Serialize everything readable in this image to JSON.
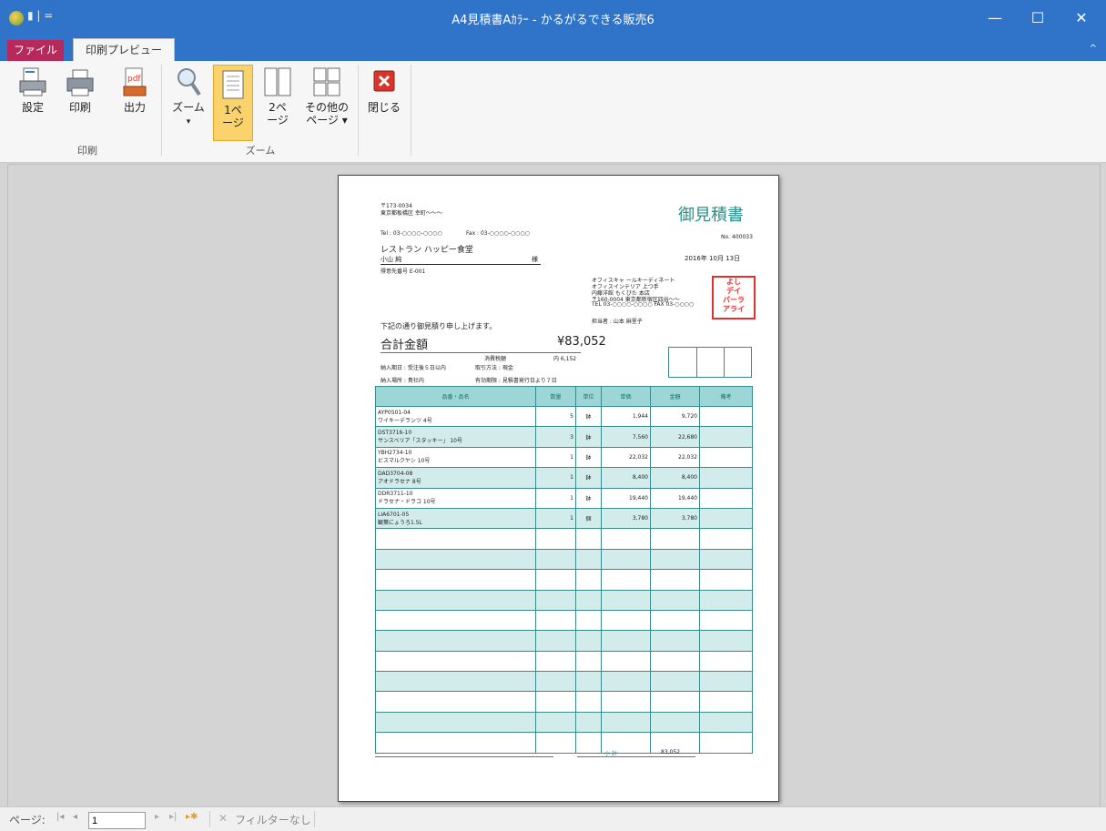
{
  "window": {
    "title": "A4見積書Aｶﾗｰ - かるがるできる販売6",
    "qat": "▮ | =",
    "minimize": "—",
    "maximize": "☐",
    "close": "✕"
  },
  "tabs": {
    "file": "ファイル",
    "preview": "印刷プレビュー",
    "collapse": "^"
  },
  "ribbon": {
    "setup": "設定",
    "print": "印刷",
    "output": "出力",
    "zoom": "ズーム",
    "zoom_caret": "▾",
    "one_page": "1ペ\nージ",
    "two_page": "2ペ\nージ",
    "other_pages": "その他の\nページ ▾",
    "close": "閉じる",
    "group_print": "印刷",
    "group_zoom": "ズーム"
  },
  "icons": {
    "setup": "setup-icon",
    "print": "printer-icon",
    "output": "pdf-icon",
    "zoom": "magnifier-icon",
    "one_page": "one-page-icon",
    "two_page": "two-page-icon",
    "more_pages": "multi-page-icon",
    "close": "close-icon"
  },
  "doc": {
    "postal": "〒173-0034",
    "address": "東京都板橋区 幸町〜〜〜",
    "tel": "Tel : 03-○○○○-○○○○",
    "fax": "Fax : 03-○○○○-○○○○",
    "title": "御見積書",
    "no_label": "No.",
    "no": "400033",
    "customer": "レストラン ハッピー食堂",
    "person": "小山 純",
    "honorific": "様",
    "customer_code": "得意先番号 E-001",
    "date": "2016年 10月 13日",
    "company_lines": [
      "オフィスキャ ールキーディネート",
      "オフィスインテリア 上つ手",
      "内藤洋館 もくびた 本店",
      "〒160-0004 東京都新宿区四谷〜〜",
      "TEL 03-○○○○-○○○○ FAX 03-○○○○"
    ],
    "stamp": "よし\nデイ\nパーラ\nアライ",
    "staff": "担当者 : 山本 麻里子",
    "intro": "下記の通り御見積り申し上げます。",
    "total_label": "合計金額",
    "total_value": "¥83,052",
    "tax_note": "消費税額",
    "tax_value": "内 6,152",
    "delivery": "納入期日 : 受注後５日以内",
    "place": "納入場所 : 貴社内",
    "payment": "取引方法 : 現金",
    "validity": "有効期限 : 見積書発行日より７日",
    "headers": [
      "品番・品名",
      "数量",
      "単位",
      "単価",
      "金額",
      "備考"
    ],
    "rows": [
      {
        "code": "AYP0501-04",
        "name": "ワイキーデランツ 4号",
        "qty": "5",
        "unit": "鉢",
        "price": "1,944",
        "amount": "9,720",
        "note": ""
      },
      {
        "code": "DST3716-10",
        "name": "サンスベリア「スタッキー」 10号",
        "qty": "3",
        "unit": "鉢",
        "price": "7,560",
        "amount": "22,680",
        "note": ""
      },
      {
        "code": "YBH2734-10",
        "name": "ビスマルクヤシ 10号",
        "qty": "1",
        "unit": "鉢",
        "price": "22,032",
        "amount": "22,032",
        "note": ""
      },
      {
        "code": "DAD3704-08",
        "name": "アオドラセナ 8号",
        "qty": "1",
        "unit": "鉢",
        "price": "8,400",
        "amount": "8,400",
        "note": ""
      },
      {
        "code": "DDR3711-10",
        "name": "ドラセナ・ドラコ 10号",
        "qty": "1",
        "unit": "鉢",
        "price": "19,440",
        "amount": "19,440",
        "note": ""
      },
      {
        "code": "LIA6701-05",
        "name": "観葉にょうろ1.5L",
        "qty": "1",
        "unit": "個",
        "price": "3,780",
        "amount": "3,780",
        "note": ""
      }
    ],
    "subtotal_label": "小 計",
    "subtotal": "83,052"
  },
  "statusbar": {
    "page_label": "ページ:",
    "page": "1",
    "filter": "フィルターなし"
  }
}
